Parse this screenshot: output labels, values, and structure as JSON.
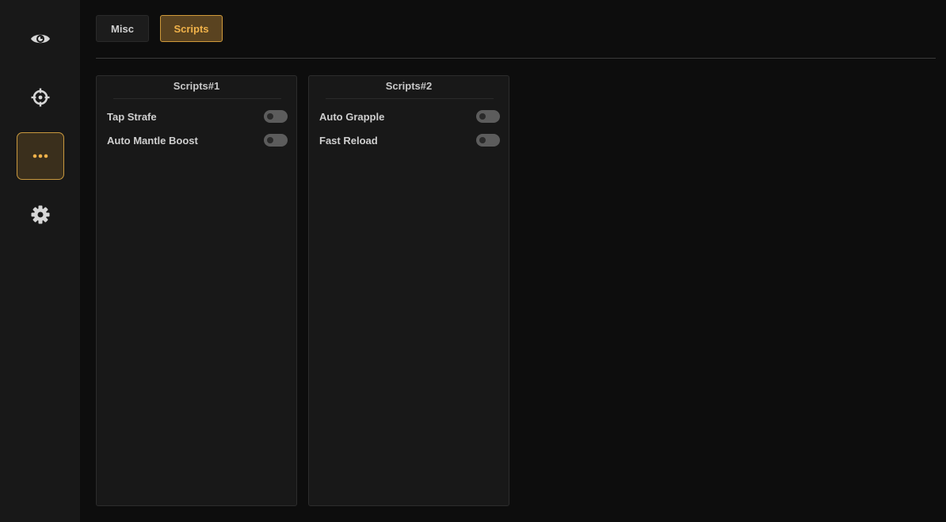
{
  "sidebar": {
    "items": [
      {
        "icon": "eye-icon",
        "active": false
      },
      {
        "icon": "crosshair-icon",
        "active": false
      },
      {
        "icon": "more-dots-icon",
        "active": true
      },
      {
        "icon": "gear-icon",
        "active": false
      }
    ]
  },
  "tabs": {
    "misc": "Misc",
    "scripts": "Scripts",
    "active": "Scripts"
  },
  "panels": [
    {
      "title": "Scripts#1",
      "rows": [
        {
          "label": "Tap Strafe",
          "enabled": false
        },
        {
          "label": "Auto Mantle Boost",
          "enabled": false
        }
      ]
    },
    {
      "title": "Scripts#2",
      "rows": [
        {
          "label": "Auto Grapple",
          "enabled": false
        },
        {
          "label": "Fast Reload",
          "enabled": false
        }
      ]
    }
  ],
  "colors": {
    "accent": "#f0b24a",
    "accent_border": "#d09a3a",
    "active_bg": "#5a4320",
    "background": "#0d0d0d",
    "panel": "#181818"
  }
}
